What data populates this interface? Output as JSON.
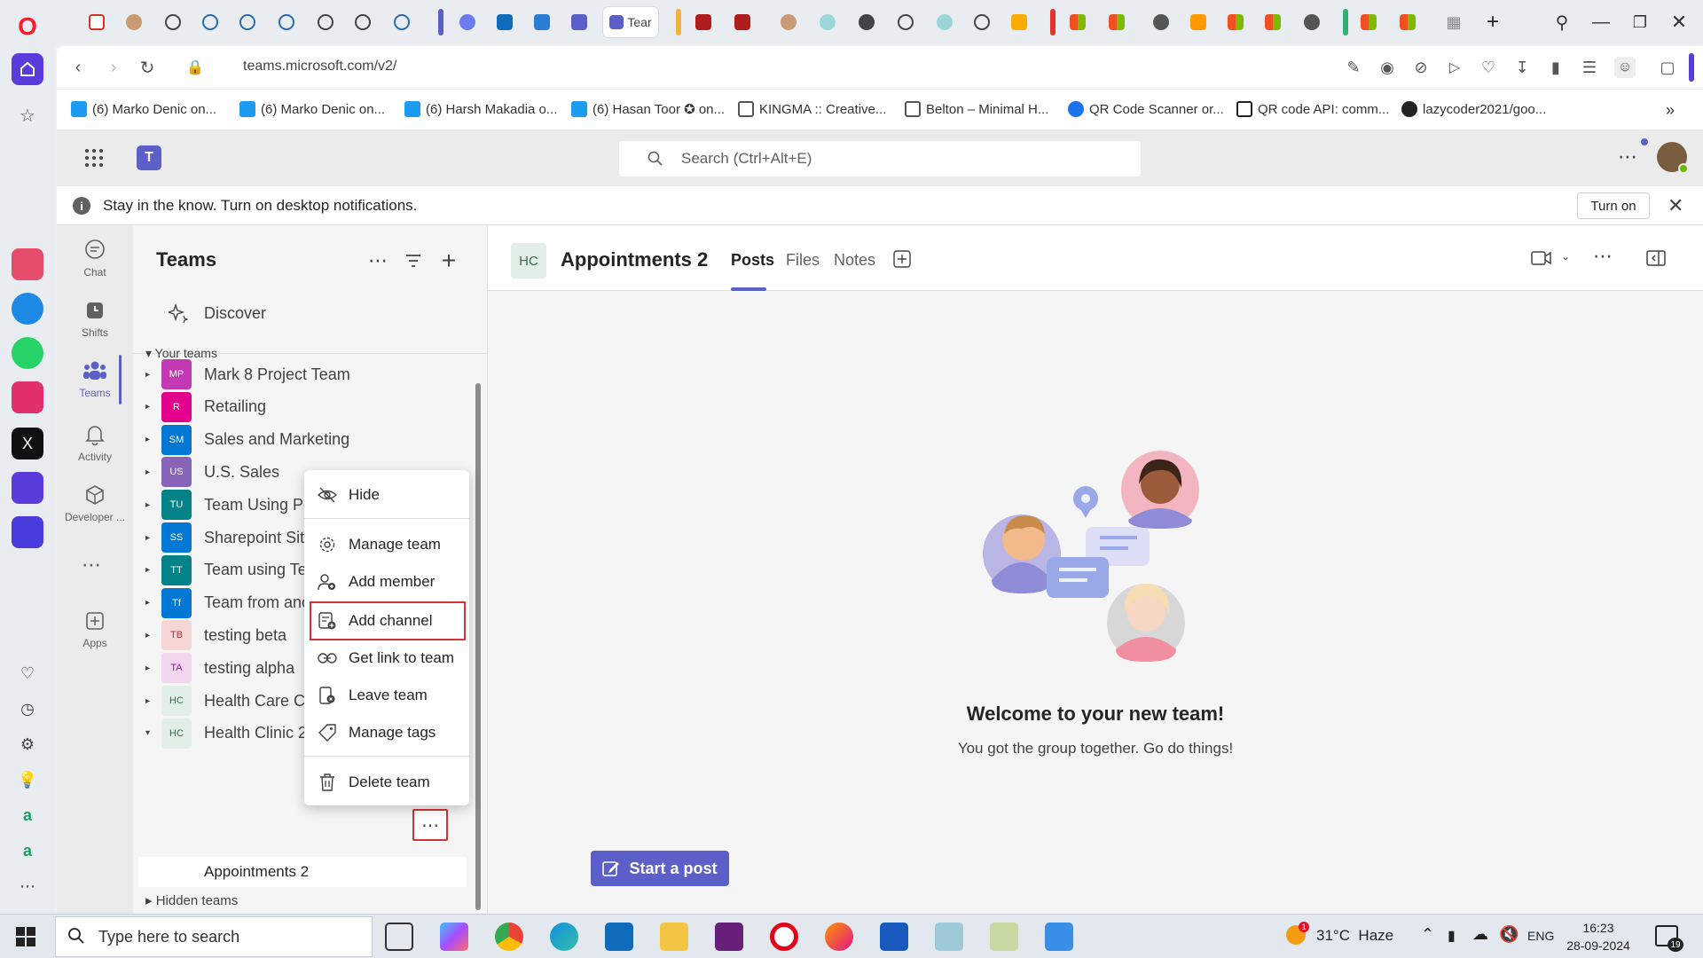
{
  "browser": {
    "url": "teams.microsoft.com/v2/",
    "active_tab_label": "Tear",
    "bookmarks": [
      "(6) Marko Denic on...",
      "(6) Marko Denic on...",
      "(6) Harsh Makadia o...",
      "(6) Hasan Toor ✪ on...",
      "KINGMA :: Creative...",
      "Belton – Minimal H...",
      "QR Code Scanner or...",
      "QR code API: comm...",
      "lazycoder2021/goo..."
    ]
  },
  "teams_header": {
    "search_placeholder": "Search (Ctrl+Alt+E)"
  },
  "notification": {
    "text": "Stay in the know. Turn on desktop notifications.",
    "button": "Turn on"
  },
  "app_rail": {
    "items": [
      "Chat",
      "Shifts",
      "Teams",
      "Activity",
      "Developer ...",
      "Apps"
    ]
  },
  "teams_pane": {
    "title": "Teams",
    "discover": "Discover",
    "your_teams": "Your teams",
    "teams": [
      {
        "initials": "MP",
        "name": "Mark 8 Project Team",
        "color": "#c239b3"
      },
      {
        "initials": "R",
        "name": "Retailing",
        "color": "#e3008c"
      },
      {
        "initials": "SM",
        "name": "Sales and Marketing",
        "color": "#0078d4"
      },
      {
        "initials": "US",
        "name": "U.S. Sales",
        "color": "#8764b8"
      },
      {
        "initials": "TU",
        "name": "Team Using Po",
        "color": "#038387"
      },
      {
        "initials": "SS",
        "name": "Sharepoint Site",
        "color": "#0078d4"
      },
      {
        "initials": "TT",
        "name": "Team using Tea",
        "color": "#038387"
      },
      {
        "initials": "Tf",
        "name": "Team from ano",
        "color": "#0078d4"
      },
      {
        "initials": "TB",
        "name": "testing beta",
        "color": "#f6d5d5"
      },
      {
        "initials": "TA",
        "name": "testing alpha",
        "color": "#f3d7ef"
      },
      {
        "initials": "HC",
        "name": "Health Care Cli",
        "color": "#e1efe6"
      },
      {
        "initials": "HC",
        "name": "Health Clinic 2",
        "color": "#e1efe6"
      }
    ],
    "channel": "Appointments 2",
    "hidden_teams": "Hidden teams"
  },
  "context_menu": {
    "items": [
      "Hide",
      "Manage team",
      "Add member",
      "Add channel",
      "Get link to team",
      "Leave team",
      "Manage tags",
      "Delete team"
    ]
  },
  "channel": {
    "avatar": "HC",
    "title": "Appointments 2",
    "tabs": [
      "Posts",
      "Files",
      "Notes"
    ],
    "welcome_title": "Welcome to your new team!",
    "welcome_sub": "You got the group together. Go do things!",
    "start_post": "Start a post"
  },
  "taskbar": {
    "search_placeholder": "Type here to search",
    "weather": "31°C  Haze",
    "lang": "ENG",
    "time": "16:23",
    "date": "28-09-2024",
    "notif_count": "19"
  }
}
